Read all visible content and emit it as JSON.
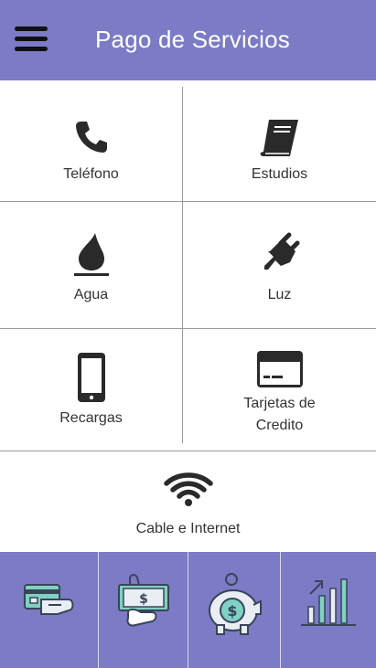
{
  "header": {
    "title": "Pago de Servicios",
    "menu_icon": "hamburger-menu-icon",
    "background": "#7b7bc6"
  },
  "services": [
    {
      "label": "Teléfono",
      "icon": "phone-icon"
    },
    {
      "label": "Estudios",
      "icon": "book-icon"
    },
    {
      "label": "Agua",
      "icon": "water-drop-icon"
    },
    {
      "label": "Luz",
      "icon": "electric-plug-icon"
    },
    {
      "label": "Recargas",
      "icon": "mobile-phone-icon"
    },
    {
      "label_line1": "Tarjetas de",
      "label_line2": "Credito",
      "icon": "credit-card-icon"
    },
    {
      "label": "Cable e Internet",
      "icon": "wifi-icon"
    }
  ],
  "tabbar": {
    "background": "#7b7bc6",
    "tabs": [
      {
        "icon": "card-payment-icon"
      },
      {
        "icon": "cash-in-hand-icon"
      },
      {
        "icon": "piggy-bank-icon"
      },
      {
        "icon": "growth-chart-icon"
      }
    ]
  }
}
